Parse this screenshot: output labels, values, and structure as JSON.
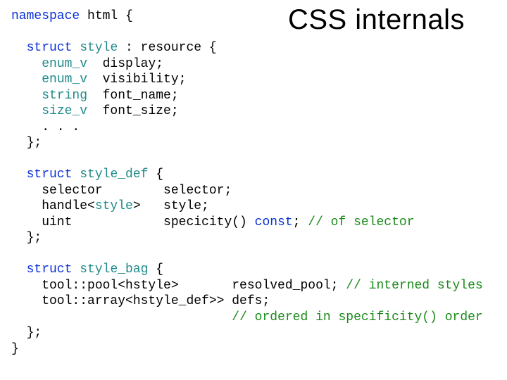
{
  "title": "CSS internals",
  "code": {
    "l01a": "namespace",
    "l01b": " html {",
    "blank1": "",
    "l02a": "  struct",
    "l02b": " ",
    "l02c": "style",
    "l02d": " : resource {",
    "l03a": "    ",
    "l03b": "enum_v",
    "l03c": "  display;",
    "l04a": "    ",
    "l04b": "enum_v",
    "l04c": "  visibility;",
    "l05a": "    ",
    "l05b": "string",
    "l05c": "  font_name;",
    "l06a": "    ",
    "l06b": "size_v",
    "l06c": "  font_size;",
    "l07": "    . . .",
    "l08": "  };",
    "blank2": "",
    "l09a": "  struct",
    "l09b": " ",
    "l09c": "style_def",
    "l09d": " {",
    "l10a": "    selector        selector;",
    "l11a": "    handle<",
    "l11b": "style",
    "l11c": ">   style;",
    "l12a": "    uint            specicity() ",
    "l12b": "const",
    "l12c": "; ",
    "l12d": "// of selector",
    "l13": "  };",
    "blank3": "",
    "l14a": "  struct",
    "l14b": " ",
    "l14c": "style_bag",
    "l14d": " {",
    "l15a": "    tool::pool<hstyle>       resolved_pool; ",
    "l15b": "// interned styles",
    "l16a": "    tool::array<hstyle_def>> defs;",
    "l17a": "                             ",
    "l17b": "// ordered in specificity() order",
    "l18": "  };",
    "l19": "}"
  }
}
